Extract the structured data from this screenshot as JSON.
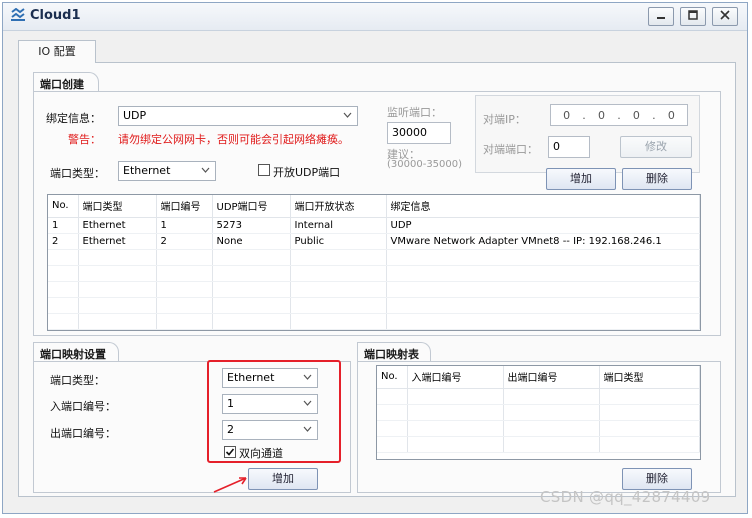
{
  "window": {
    "title": "Cloud1"
  },
  "tabs": [
    {
      "label": "IO 配置"
    }
  ],
  "port_creation": {
    "section_title": "端口创建",
    "binding_label": "绑定信息：",
    "binding_value": "UDP",
    "warning_label": "警告：",
    "warning_text": "请勿绑定公网网卡，否则可能会引起网络瘫痪。",
    "port_type_label": "端口类型：",
    "port_type_value": "Ethernet",
    "open_udp_label": "开放UDP端口",
    "listen_port_label": "监听端口：",
    "listen_port_value": "30000",
    "suggest_label": "建议：",
    "suggest_range": "(30000-35000)",
    "peer_ip_label": "对端IP：",
    "peer_ip_octets": [
      "0",
      "0",
      "0",
      "0"
    ],
    "peer_port_label": "对端端口：",
    "peer_port_value": "0",
    "modify_button": "修改",
    "add_button": "增加",
    "delete_button": "删除",
    "table": {
      "headers": [
        "No.",
        "端口类型",
        "端口编号",
        "UDP端口号",
        "端口开放状态",
        "绑定信息"
      ],
      "rows": [
        [
          "1",
          "Ethernet",
          "1",
          "5273",
          "Internal",
          "UDP"
        ],
        [
          "2",
          "Ethernet",
          "2",
          "None",
          "Public",
          "VMware Network Adapter VMnet8 -- IP: 192.168.246.1"
        ]
      ]
    }
  },
  "port_mapping_settings": {
    "section_title": "端口映射设置",
    "port_type_label": "端口类型：",
    "port_type_value": "Ethernet",
    "in_port_label": "入端口编号：",
    "in_port_value": "1",
    "out_port_label": "出端口编号：",
    "out_port_value": "2",
    "bidirectional_label": "双向通道",
    "bidirectional_checked": true,
    "add_button": "增加"
  },
  "port_mapping_table": {
    "section_title": "端口映射表",
    "headers": [
      "No.",
      "入端口编号",
      "出端口编号",
      "端口类型"
    ],
    "delete_button": "删除"
  },
  "watermark": "CSDN @qq_42874409",
  "colors": {
    "highlight": "#e5202a",
    "warning": "#e01a1a",
    "title": "#1b2e4f"
  },
  "icons": {
    "app": "cloud-app-icon",
    "minimize": "minimize-icon",
    "maximize": "maximize-icon",
    "close": "close-icon",
    "dropdown": "chevron-down-icon",
    "annotation": "red-arrow-icon"
  }
}
